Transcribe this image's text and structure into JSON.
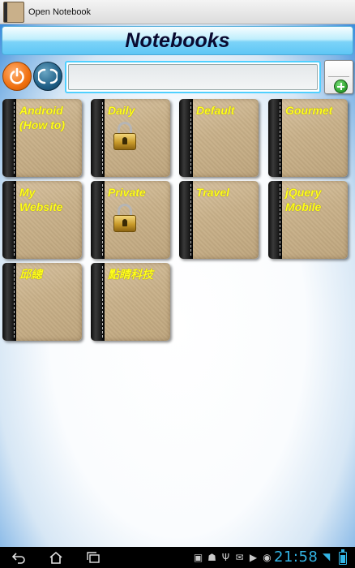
{
  "window": {
    "title": "Open Notebook"
  },
  "header": {
    "title": "Notebooks"
  },
  "toolbar": {
    "power_icon": "power-icon",
    "sync_icon": "sync-icon",
    "search_value": "",
    "new_notebook_icon": "new-notebook-icon"
  },
  "notebooks": [
    {
      "label": "Android (How to)",
      "locked": false
    },
    {
      "label": "Daily",
      "locked": true
    },
    {
      "label": "Default",
      "locked": false
    },
    {
      "label": "Gourmet",
      "locked": false
    },
    {
      "label": "My Website",
      "locked": false
    },
    {
      "label": "Private",
      "locked": true
    },
    {
      "label": "Travel",
      "locked": false
    },
    {
      "label": "jQuery Mobile",
      "locked": false
    },
    {
      "label": "邱總",
      "locked": false
    },
    {
      "label": "點睛科技",
      "locked": false
    }
  ],
  "system_bar": {
    "time": "21:58",
    "accent_color": "#33b5e5"
  },
  "colors": {
    "notebook_label": "#ffff1a",
    "header_text": "#0a0a30",
    "search_border": "#4fd0ff"
  }
}
